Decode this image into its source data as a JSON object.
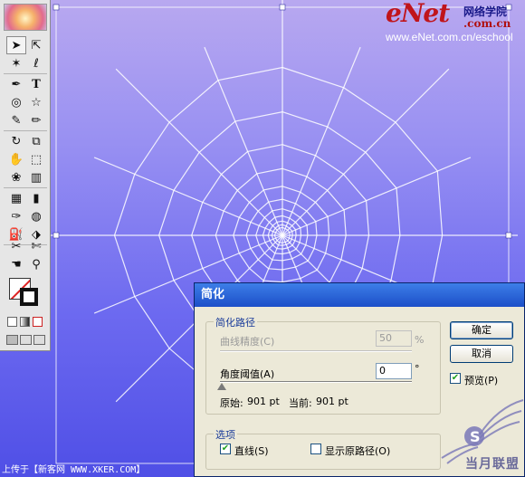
{
  "colors": {
    "canvas_top": "#b8a8f0",
    "canvas_bottom": "#4f4fe6",
    "web_line": "#ffffff",
    "dialog_title": "#1c4fc8"
  },
  "toolbox": {
    "tools": [
      "selection-tool",
      "direct-selection-tool",
      "magic-wand-tool",
      "lasso-tool",
      "pen-tool",
      "type-tool",
      "line-segment-tool",
      "rectangle-tool",
      "rotate-tool",
      "star-tool",
      "brush-tool",
      "pencil-tool",
      "rotate-view-tool",
      "scale-tool",
      "warp-tool",
      "free-transform-tool",
      "symbol-sprayer-tool",
      "column-graph-tool",
      "mesh-tool",
      "gradient-tool",
      "eyedropper-tool",
      "blend-tool",
      "live-paint-tool",
      "live-paint-selection-tool",
      "slice-tool",
      "scissors-tool",
      "hand-tool",
      "zoom-tool"
    ],
    "type_glyph": "T"
  },
  "logo": {
    "brand": "eNet",
    "chinese": "网络学院",
    "dotcom": ".com.cn",
    "url": "www.eNet.com.cn/eschool"
  },
  "dialog": {
    "title": "简化",
    "group_path": "简化路径",
    "curve_precision_label": "曲线精度(C)",
    "curve_precision_value": "50",
    "curve_precision_unit": "%",
    "angle_label": "角度阈值(A)",
    "angle_value": "0",
    "angle_unit": "°",
    "original_label": "原始:",
    "original_value": "901 pt",
    "current_label": "当前:",
    "current_value": "901 pt",
    "group_options": "选项",
    "straight_lines_label": "直线(S)",
    "straight_lines_checked": true,
    "show_original_label": "显示原路径(O)",
    "show_original_checked": false,
    "ok": "确定",
    "cancel": "取消",
    "preview_label": "预览(P)",
    "preview_checked": true
  },
  "watermark": {
    "text": "当月联盟"
  },
  "footer": "上传于【新客网 WWW.XKER.COM】"
}
